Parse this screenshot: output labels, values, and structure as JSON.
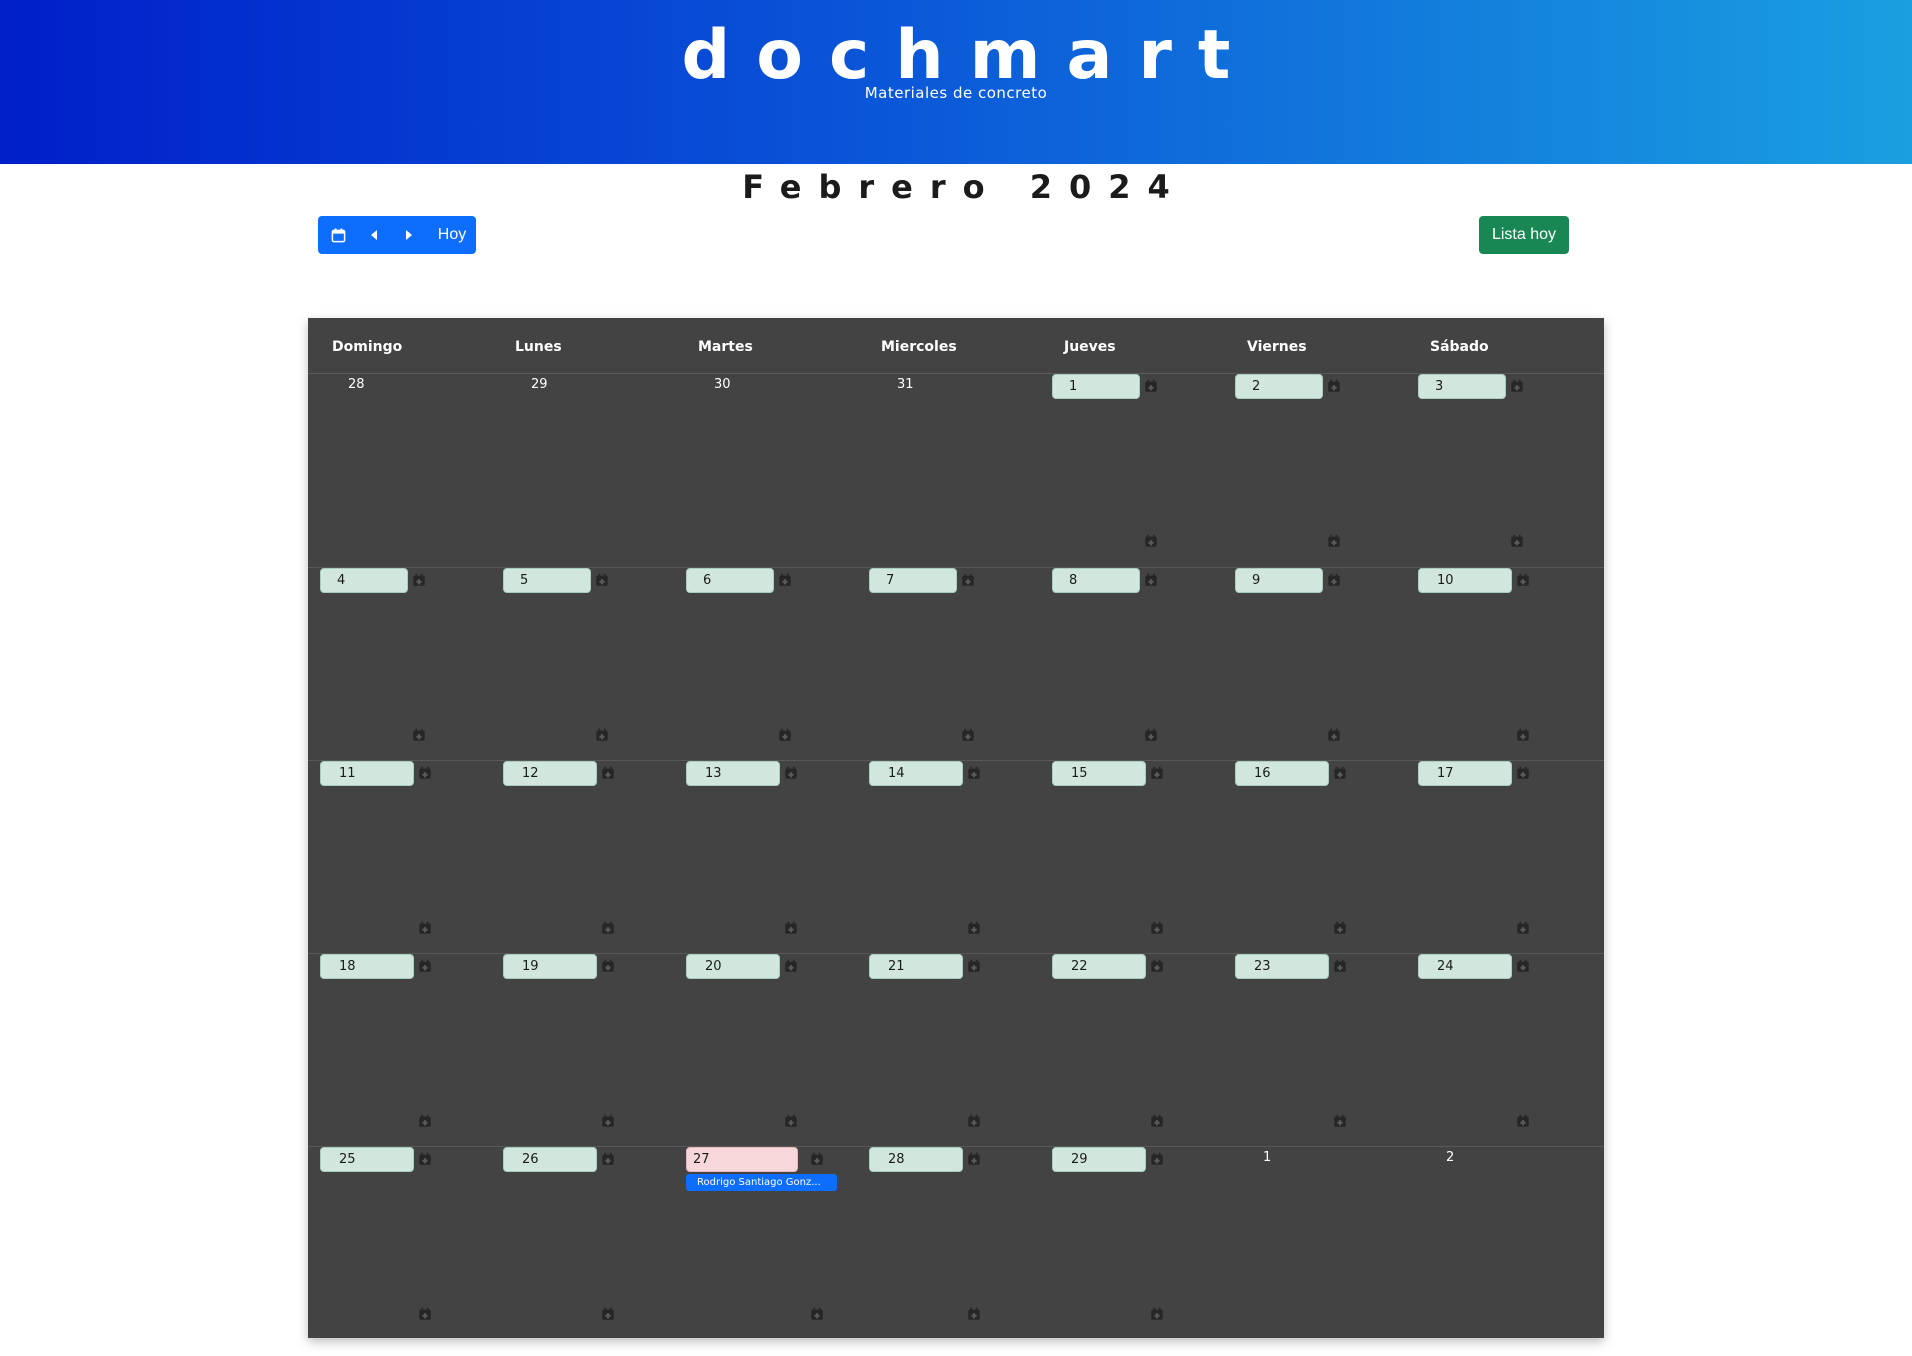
{
  "header": {
    "brand": "dochmart",
    "tagline": "Materiales de concreto",
    "colors": {
      "gradient_start": "#001fc9",
      "gradient_end": "#1a9fe0"
    }
  },
  "calendar_title": "Febrero 2024",
  "toolbar": {
    "calendar_icon": "calendar-icon",
    "prev_icon": "caret-left-icon",
    "next_icon": "caret-right-icon",
    "today_label": "Hoy",
    "lista_hoy_label": "Lista hoy",
    "colors": {
      "primary": "#0d6efd",
      "success": "#198754"
    }
  },
  "weekdays": [
    "Domingo",
    "Lunes",
    "Martes",
    "Miercoles",
    "Jueves",
    "Viernes",
    "Sábado"
  ],
  "weeks": [
    [
      {
        "day": "28",
        "in_month": false
      },
      {
        "day": "29",
        "in_month": false
      },
      {
        "day": "30",
        "in_month": false
      },
      {
        "day": "31",
        "in_month": false
      },
      {
        "day": "1",
        "in_month": true
      },
      {
        "day": "2",
        "in_month": true
      },
      {
        "day": "3",
        "in_month": true
      }
    ],
    [
      {
        "day": "4",
        "in_month": true
      },
      {
        "day": "5",
        "in_month": true
      },
      {
        "day": "6",
        "in_month": true
      },
      {
        "day": "7",
        "in_month": true
      },
      {
        "day": "8",
        "in_month": true
      },
      {
        "day": "9",
        "in_month": true
      },
      {
        "day": "10",
        "in_month": true
      }
    ],
    [
      {
        "day": "11",
        "in_month": true
      },
      {
        "day": "12",
        "in_month": true
      },
      {
        "day": "13",
        "in_month": true
      },
      {
        "day": "14",
        "in_month": true
      },
      {
        "day": "15",
        "in_month": true
      },
      {
        "day": "16",
        "in_month": true
      },
      {
        "day": "17",
        "in_month": true
      }
    ],
    [
      {
        "day": "18",
        "in_month": true
      },
      {
        "day": "19",
        "in_month": true
      },
      {
        "day": "20",
        "in_month": true
      },
      {
        "day": "21",
        "in_month": true
      },
      {
        "day": "22",
        "in_month": true
      },
      {
        "day": "23",
        "in_month": true
      },
      {
        "day": "24",
        "in_month": true
      }
    ],
    [
      {
        "day": "25",
        "in_month": true
      },
      {
        "day": "26",
        "in_month": true
      },
      {
        "day": "27",
        "in_month": true,
        "today": true,
        "events": [
          "Rodrigo Santiago Gonz..."
        ]
      },
      {
        "day": "28",
        "in_month": true
      },
      {
        "day": "29",
        "in_month": true
      },
      {
        "day": "1",
        "in_month": false
      },
      {
        "day": "2",
        "in_month": false
      }
    ]
  ],
  "colors": {
    "calendar_bg": "#434343",
    "day_pill": "#d1e7dd",
    "today_pill": "#f8d7da",
    "event": "#0d6efd"
  }
}
